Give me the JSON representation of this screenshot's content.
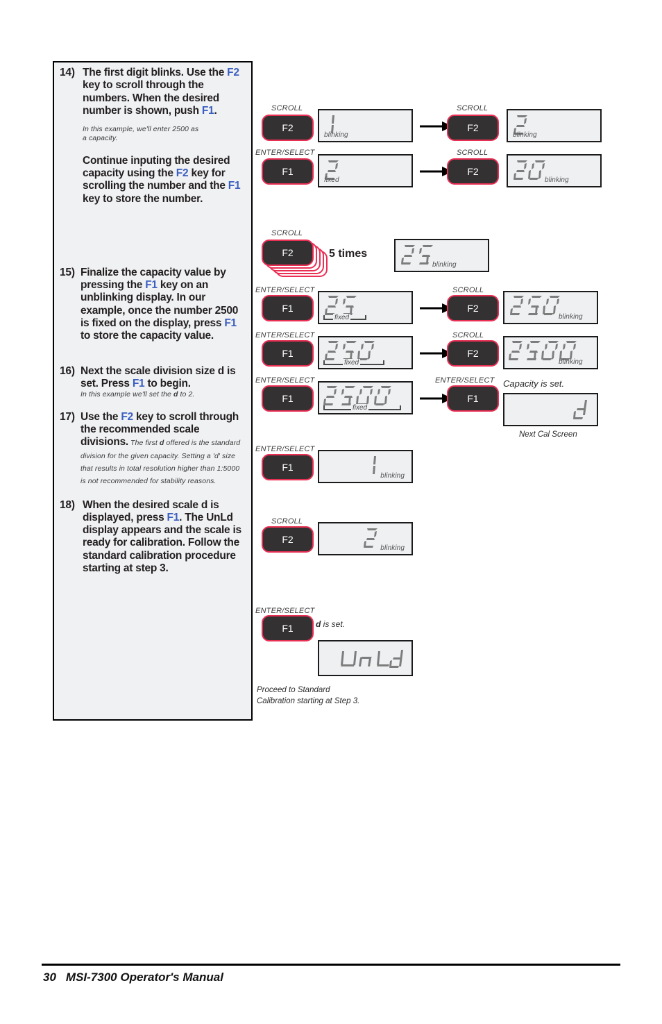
{
  "page": {
    "number": "30",
    "manual_title": "MSI-7300 Operator's Manual"
  },
  "steps": [
    {
      "num": "14)",
      "text_parts": [
        "The first digit blinks. Use the ",
        "F2",
        " key to scroll through the numbers. When the desired number is shown, push ",
        "F1",
        "."
      ],
      "note": "In this example, we'll enter 2500 as a capacity."
    },
    {
      "num": "",
      "text_parts": [
        "Continue inputing the desired capacity using the ",
        "F2",
        " key for scrolling the number and the ",
        "F1",
        " key to store the number."
      ]
    },
    {
      "num": "15)",
      "text_parts": [
        "Finalize the capacity value by pressing the ",
        "F1",
        " key on an unblinking display. In our example, once the number 2500 is fixed on the display, press ",
        "F1",
        " to store the capacity value."
      ]
    },
    {
      "num": "16)",
      "text_parts": [
        "Next the scale division size d is set. Press ",
        "F1",
        " to begin."
      ],
      "note": "In this example we'll set the d to 2."
    },
    {
      "num": "17)",
      "text_parts": [
        "Use the ",
        "F2",
        " key to scroll through the recommended scale divisions."
      ],
      "note": "The first d offered is the standard division for the given capacity. Setting a 'd' size that results in total resolution higher than 1:5000 is not recommended for stability reasons."
    },
    {
      "num": "18)",
      "text_parts": [
        "When the desired scale d is displayed, press ",
        "F1",
        ". The UnLd display appears and the scale is ready for calibration. Follow the standard calibration procedure starting at step 3."
      ]
    }
  ],
  "step14": {
    "num": "14)",
    "p1_a": "The first digit blinks. Use the ",
    "p1_f2": "F2",
    "p1_b": " key to scroll through the numbers. When the desired number is shown, push ",
    "p1_f1": "F1",
    "p1_c": ".",
    "note_l1": "In this example, we'll enter 2500 as",
    "note_l2": "a capacity.",
    "p2_a": "Continue inputing the desired capacity using the ",
    "p2_f2": "F2",
    "p2_b": " key for scrolling the number and the ",
    "p2_f1": "F1",
    "p2_c": " key to store the number."
  },
  "step15": {
    "num": "15)",
    "a": "Finalize the capacity value by pressing the ",
    "f1a": "F1",
    "b": " key on an unblinking display. In our example, once the number 2500 is fixed on the display, press ",
    "f1b": "F1",
    "c": " to store the capacity value."
  },
  "step16": {
    "num": "16)",
    "a": "Next the scale division size ",
    "d": "d",
    "b": " is set. Press ",
    "f1": "F1",
    "c": " to begin.",
    "note_a": "In this example we'll set the ",
    "note_d": "d",
    "note_b": " to 2."
  },
  "step17": {
    "num": "17)",
    "a": "Use the ",
    "f2": "F2",
    "b": " key to scroll through the recommended scale divisions.",
    "note_a": " The first ",
    "note_d": "d",
    "note_b": " offered is the standard division for the given capacity. Setting a 'd' size that results in total resolution higher than 1:5000 is not recommended for stability reasons."
  },
  "step18": {
    "num": "18)",
    "a": "When the desired scale ",
    "d": "d",
    "b": " is displayed, press ",
    "f1": "F1",
    "c": ". The ",
    "unld": "UnLd",
    "e": " display appears and the scale is ready for calibration. Follow the standard calibration procedure starting at step 3."
  },
  "diagram": {
    "key_labels": {
      "scroll": "SCROLL",
      "enter_select": "ENTER/SELECT"
    },
    "buttons": {
      "f1": "F1",
      "f2": "F2"
    },
    "tags": {
      "blinking": "blinking",
      "fixed": "fixed"
    },
    "rows": [
      {
        "id": "r1",
        "key_label": "SCROLL",
        "button": "F2",
        "display": "1",
        "tag": "blinking"
      },
      {
        "id": "r1b",
        "key_label": "SCROLL",
        "button": "F2",
        "display": "2",
        "tag": "blinking"
      },
      {
        "id": "r2",
        "key_label": "ENTER/SELECT",
        "button": "F1",
        "display": "2",
        "tag": "fixed"
      },
      {
        "id": "r2b",
        "key_label": "SCROLL",
        "button": "F2",
        "display": "20",
        "tag": "blinking"
      },
      {
        "id": "r3",
        "key_label": "SCROLL",
        "button": "F2",
        "display": "25",
        "tag": "blinking",
        "repeat": "5 times"
      },
      {
        "id": "r4",
        "key_label": "ENTER/SELECT",
        "button": "F1",
        "display": "25",
        "tag": "fixed"
      },
      {
        "id": "r4b",
        "key_label": "SCROLL",
        "button": "F2",
        "display": "250",
        "tag": "blinking"
      },
      {
        "id": "r5",
        "key_label": "ENTER/SELECT",
        "button": "F1",
        "display": "250",
        "tag": "fixed"
      },
      {
        "id": "r5b",
        "key_label": "SCROLL",
        "button": "F2",
        "display": "2500",
        "tag": "blinking"
      },
      {
        "id": "r6",
        "key_label": "ENTER/SELECT",
        "button": "F1",
        "display": "2500",
        "tag": "fixed"
      },
      {
        "id": "r6b",
        "key_label": "ENTER/SELECT",
        "button": "F1",
        "display": "d",
        "tag": ""
      },
      {
        "id": "r7",
        "key_label": "ENTER/SELECT",
        "button": "F1",
        "display": "1",
        "tag": "blinking"
      },
      {
        "id": "r8",
        "key_label": "SCROLL",
        "button": "F2",
        "display": "2",
        "tag": "blinking"
      },
      {
        "id": "r9",
        "key_label": "ENTER/SELECT",
        "button": "F1",
        "display": "UnLd",
        "tag": ""
      }
    ],
    "repeat_label": "5 times",
    "capacity_set": "Capacity is set.",
    "next_cal_screen": "Next Cal Screen",
    "d_is_set_a": "d",
    "d_is_set_b": " is set.",
    "proceed_l1": "Proceed to Standard",
    "proceed_l2": "Calibration starting at Step 3."
  },
  "colors": {
    "fkey_blue": "#3b5fc0",
    "button_fill": "#333132",
    "button_border": "#ea2f54",
    "lcd_bg": "#eef0f2",
    "lcd_border": "#1b1b1b",
    "text": "#231f20"
  }
}
